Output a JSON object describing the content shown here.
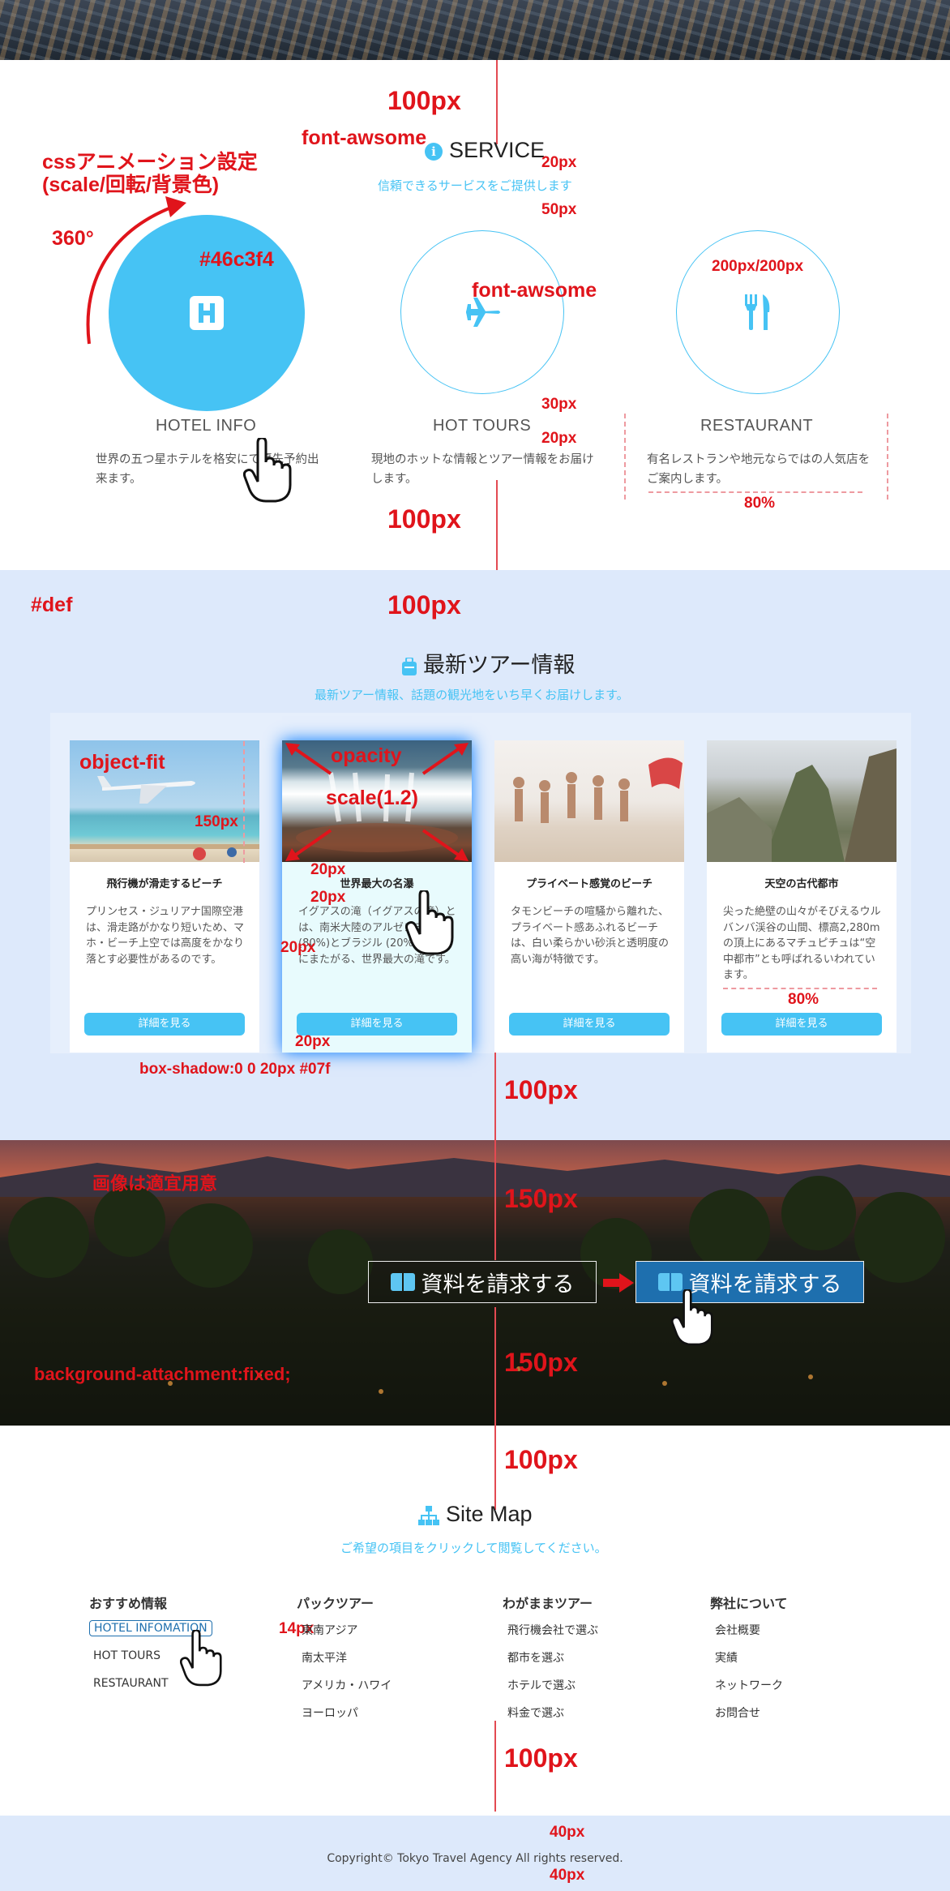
{
  "service": {
    "title": "SERVICE",
    "subtitle": "信頼できるサービスをご提供します",
    "items": [
      {
        "name": "HOTEL INFO",
        "desc": "世界の五つ星ホテルを格安にて優先予約出来ます。",
        "icon": "hotel-icon"
      },
      {
        "name": "HOT TOURS",
        "desc": "現地のホットな情報とツアー情報をお届けします。",
        "icon": "plane-icon"
      },
      {
        "name": "RESTAURANT",
        "desc": "有名レストランや地元ならではの人気店をご案内します。",
        "icon": "utensils-icon"
      }
    ]
  },
  "tours": {
    "title": "最新ツアー情報",
    "subtitle": "最新ツアー情報、話題の観光地をいち早くお届けします。",
    "button_label": "詳細を見る",
    "cards": [
      {
        "title": "飛行機が滑走するビーチ",
        "desc": "プリンセス・ジュリアナ国際空港は、滑走路がかなり短いため、マホ・ビーチ上空では高度をかなり落とす必要性があるのです。"
      },
      {
        "title": "世界最大の名瀑",
        "desc": "イグアスの滝（イグアスの滝）とは、南米大陸のアルゼンチン (80%)とブラジル (20%)の二国にまたがる、世界最大の滝です。"
      },
      {
        "title": "プライベート感覚のビーチ",
        "desc": "タモンビーチの喧騒から離れた、プライベート感あふれるビーチは、白い柔らかい砂浜と透明度の高い海が特徴です。"
      },
      {
        "title": "天空の古代都市",
        "desc": "尖った絶壁の山々がそびえるウルバンバ渓谷の山間、標高2,280mの頂上にあるマチュピチュは“空中都市”とも呼ばれるいわれています。"
      }
    ]
  },
  "request": {
    "label": "資料を請求する"
  },
  "sitemap": {
    "title": "Site Map",
    "subtitle": "ご希望の項目をクリックして閲覧してください。",
    "columns": [
      {
        "head": "おすすめ情報",
        "links": [
          "HOTEL INFOMATION",
          "HOT TOURS",
          "RESTAURANT"
        ]
      },
      {
        "head": "パックツアー",
        "links": [
          "東南アジア",
          "南太平洋",
          "アメリカ・ハワイ",
          "ヨーロッパ"
        ]
      },
      {
        "head": "わがままツアー",
        "links": [
          "飛行機会社で選ぶ",
          "都市を選ぶ",
          "ホテルで選ぶ",
          "料金で選ぶ"
        ]
      },
      {
        "head": "弊社について",
        "links": [
          "会社概要",
          "実績",
          "ネットワーク",
          "お問合せ"
        ]
      }
    ]
  },
  "footer": {
    "copyright": "Copyright© Tokyo Travel Agency All rights reserved."
  },
  "annotations": {
    "px100": "100px",
    "px150": "150px",
    "px20": "20px",
    "px50": "50px",
    "px30": "30px",
    "px40": "40px",
    "px14": "14px",
    "percent80": "80%",
    "fa": "font-awsome",
    "css_anim_1": "cssアニメーション設定",
    "css_anim_2": "(scale/回転/背景色)",
    "deg360": "360°",
    "color_hex": "#46c3f4",
    "circle_size": "200px/200px",
    "def": "#def",
    "object_fit": "object-fit",
    "opacity": "opacity",
    "scale": "scale(1.2)",
    "box_shadow": "box-shadow:0 0 20px #07f",
    "image_note": "画像は適宜用意",
    "bg_fixed": "background-attachment:fixed;"
  }
}
